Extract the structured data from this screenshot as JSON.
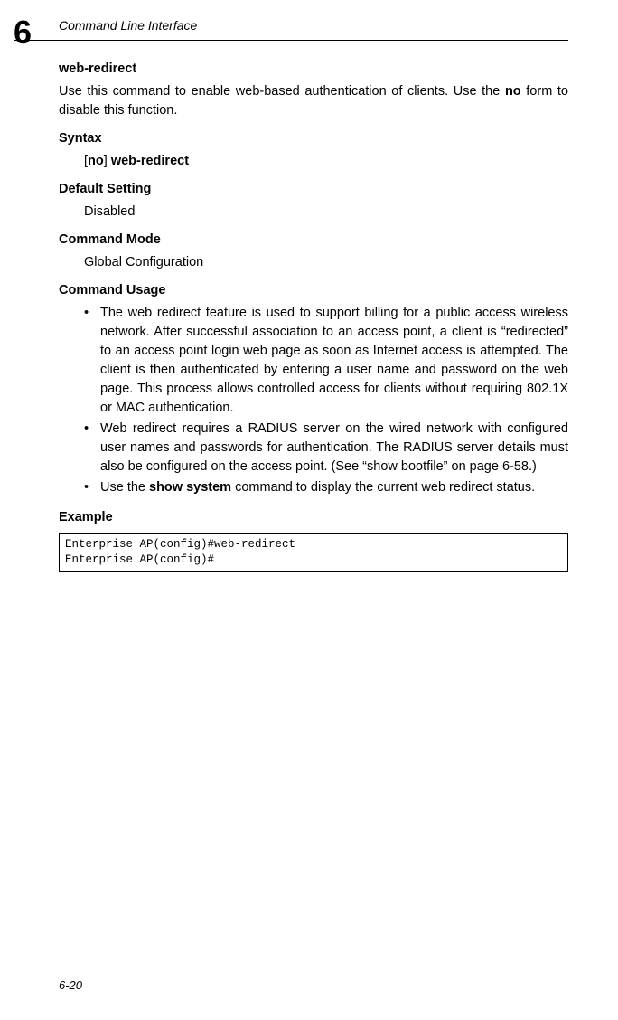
{
  "chapter_number": "6",
  "chapter_title": "Command Line Interface",
  "cmd_name": "web-redirect",
  "intro": "Use this command to enable web-based authentication of clients. Use the ",
  "intro_bold": "no",
  "intro2": " form to disable this function.",
  "syntax_label": "Syntax",
  "syntax_open": "[",
  "syntax_no": "no",
  "syntax_close": "] ",
  "syntax_cmd": "web-redirect",
  "default_label": "Default Setting",
  "default_value": "Disabled",
  "mode_label": "Command Mode",
  "mode_value": "Global Configuration",
  "usage_label": "Command Usage",
  "bullets": [
    "The web redirect feature is used to support billing for a public access wireless network. After successful association to an access point, a client is “redirected” to an access point login web page as soon as Internet access is attempted. The client is then authenticated by entering a user name and password on the web page. This process allows controlled access for clients without requiring 802.1X or MAC authentication.",
    "Web redirect requires a RADIUS server on the wired network with configured user names and passwords for authentication. The RADIUS server details must also be configured on the access point. (See “show bootfile” on page 6-58.)"
  ],
  "bullet3_a": "Use the ",
  "bullet3_b": "show system",
  "bullet3_c": " command to display the current web redirect status.",
  "example_label": "Example",
  "code": "Enterprise AP(config)#web-redirect\nEnterprise AP(config)#",
  "page_number": "6-20"
}
